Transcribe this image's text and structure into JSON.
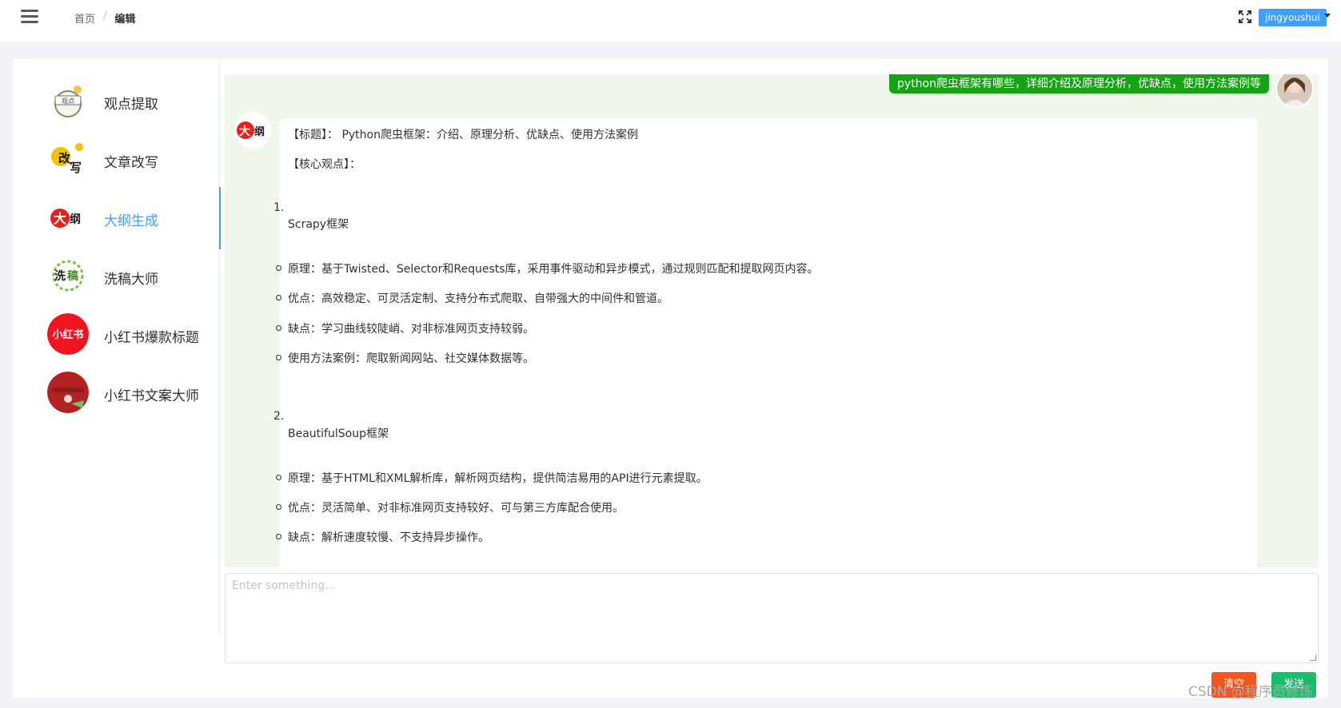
{
  "header": {
    "breadcrumb_home": "首页",
    "breadcrumb_sep": "/",
    "breadcrumb_current": "编辑",
    "username": "jingyoushui"
  },
  "sidebar": {
    "items": [
      {
        "label": "观点提取",
        "icon": "viewpoint-icon"
      },
      {
        "label": "文章改写",
        "icon": "rewrite-icon"
      },
      {
        "label": "大纲生成",
        "icon": "outline-icon"
      },
      {
        "label": "洗稿大师",
        "icon": "wash-icon"
      },
      {
        "label": "小红书爆款标题",
        "icon": "xiaohongshu-icon"
      },
      {
        "label": "小红书文案大师",
        "icon": "copywriter-icon"
      }
    ],
    "active_index": 2
  },
  "chat": {
    "user_message": "python爬虫框架有哪些，详细介绍及原理分析，优缺点，使用方法案例等",
    "bot": {
      "title": "【标题】：  Python爬虫框架：介绍、原理分析、优缺点、使用方法案例",
      "core": "【核心观点】：",
      "sections": [
        {
          "num": "1.",
          "name": "Scrapy框架",
          "bullets": [
            "原理：基于Twisted、Selector和Requests库，采用事件驱动和异步模式，通过规则匹配和提取网页内容。",
            "优点：高效稳定、可灵活定制、支持分布式爬取、自带强大的中间件和管道。",
            "缺点：学习曲线较陡峭、对非标准网页支持较弱。",
            "使用方法案例：爬取新闻网站、社交媒体数据等。"
          ]
        },
        {
          "num": "2.",
          "name": "BeautifulSoup框架",
          "bullets": [
            "原理：基于HTML和XML解析库，解析网页结构，提供简洁易用的API进行元素提取。",
            "优点：灵活简单、对非标准网页支持较好、可与第三方库配合使用。",
            "缺点：解析速度较慢、不支持异步操作。"
          ]
        }
      ]
    }
  },
  "input": {
    "placeholder": "Enter something..."
  },
  "buttons": {
    "clear": "清空",
    "send": "发送"
  },
  "watermark": "CSDN @程序员修炼",
  "colors": {
    "accent": "#409eff",
    "user_bubble": "#15a315",
    "chat_bg": "#eef7ea",
    "clear": "#f0561d",
    "send": "#19be6b"
  }
}
